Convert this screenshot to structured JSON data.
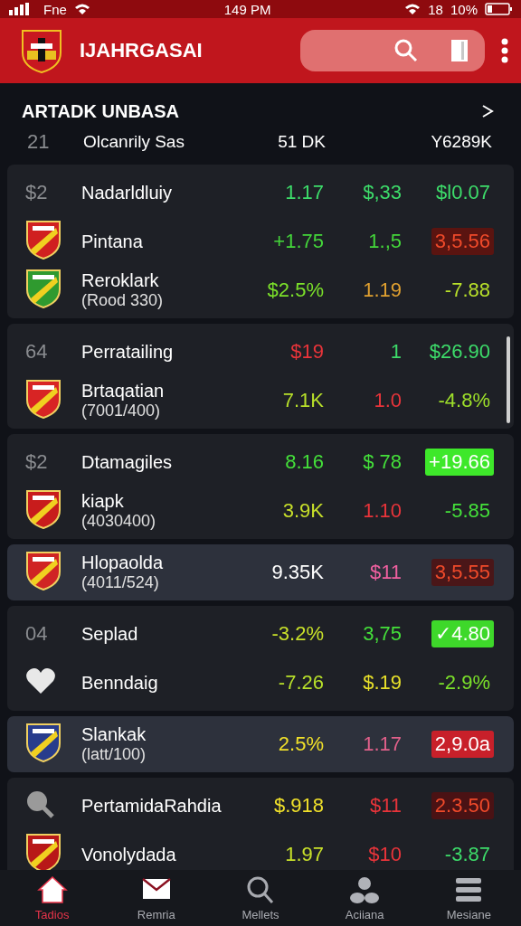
{
  "status_bar": {
    "carrier": "Fne",
    "time": "149 PM",
    "indicator": "18",
    "battery_text": "10%"
  },
  "app_bar": {
    "title": "IJAHRGASAI"
  },
  "section": {
    "title": "ARTADK UNBASA"
  },
  "header_row": {
    "number": "21",
    "name": "Olcanrily Sas",
    "column_a": "51 DK",
    "column_b": "Y6289K"
  },
  "groups": [
    {
      "highlighted": false,
      "rows": [
        {
          "lead": {
            "kind": "number",
            "text": "$2"
          },
          "name": "Nadarldluiy",
          "values": [
            {
              "text": "1.17",
              "color": "#3ddc6a"
            },
            {
              "text": "$,33",
              "color": "#3ddc6a"
            },
            {
              "text": "$l0.07",
              "color": "#3ddc6a"
            }
          ]
        },
        {
          "lead": {
            "kind": "crest",
            "color": "#d02020"
          },
          "name": "Pintana",
          "values": [
            {
              "text": "+1.75",
              "color": "#44d63a"
            },
            {
              "text": "1.,5",
              "color": "#44d63a"
            },
            {
              "text": "3,5.56",
              "kind": "tag",
              "color": "#5a1410"
            }
          ]
        },
        {
          "lead": {
            "kind": "crest",
            "color": "#2f9a2f"
          },
          "name": "Reroklark",
          "sub": "(Rood 330)",
          "values": [
            {
              "text": "$2.5%",
              "color": "#7be02a"
            },
            {
              "text": "1.19",
              "color": "#e0a030"
            },
            {
              "text": "-7.88",
              "color": "#b8e02a"
            }
          ]
        }
      ]
    },
    {
      "highlighted": false,
      "rows": [
        {
          "lead": {
            "kind": "number",
            "text": "64"
          },
          "name": "Perratailing",
          "values": [
            {
              "text": "$19",
              "color": "#e8343a"
            },
            {
              "text": "1",
              "color": "#3ddc6a"
            },
            {
              "text": "$26.90",
              "color": "#3ddc6a"
            }
          ]
        },
        {
          "lead": {
            "kind": "crest",
            "color": "#d82424"
          },
          "name": "Brtaqatian",
          "sub": "(7001/400)",
          "values": [
            {
              "text": "7.1K",
              "color": "#b8e02a"
            },
            {
              "text": "1.0",
              "color": "#e8343a"
            },
            {
              "text": "-4.8%",
              "color": "#9ee02a"
            }
          ]
        }
      ]
    },
    {
      "highlighted": false,
      "rows": [
        {
          "lead": {
            "kind": "number",
            "text": "$2"
          },
          "name": "Dtamagiles",
          "values": [
            {
              "text": "8.16",
              "color": "#44e03a"
            },
            {
              "text": "$ 78",
              "color": "#44e03a"
            },
            {
              "text": "+19.66",
              "kind": "tag",
              "color": "#3ee82a"
            }
          ]
        },
        {
          "lead": {
            "kind": "crest",
            "color": "#c81c1c"
          },
          "name": "kiapk",
          "sub": "(4030400)",
          "values": [
            {
              "text": "3.9K",
              "color": "#c8e02a"
            },
            {
              "text": "1.10",
              "color": "#e8343a"
            },
            {
              "text": "-5.85",
              "color": "#44e03a"
            }
          ]
        }
      ]
    },
    {
      "highlighted": true,
      "rows": [
        {
          "lead": {
            "kind": "crest",
            "color": "#d02424"
          },
          "name": "Hlopaolda",
          "sub": "(4011/524)",
          "values": [
            {
              "text": "9.35K",
              "color": "#ffffff"
            },
            {
              "text": "$11",
              "color": "#f060a0"
            },
            {
              "text": "3,5.55",
              "kind": "tag",
              "color": "#4a1618"
            }
          ]
        }
      ]
    },
    {
      "highlighted": false,
      "rows": [
        {
          "lead": {
            "kind": "number",
            "text": "04"
          },
          "name": "Seplad",
          "values": [
            {
              "text": "-3.2%",
              "color": "#c8e02a"
            },
            {
              "text": "3,75",
              "color": "#44e03a"
            },
            {
              "text": "✓4.80",
              "kind": "tag",
              "color": "#3ed82a"
            }
          ]
        },
        {
          "lead": {
            "kind": "heart"
          },
          "name": "Benndaig",
          "values": [
            {
              "text": "-7.26",
              "color": "#b8e02a"
            },
            {
              "text": "$.19",
              "color": "#e8e02a"
            },
            {
              "text": "-2.9%",
              "color": "#7be02a"
            }
          ]
        }
      ]
    },
    {
      "highlighted": true,
      "rows": [
        {
          "lead": {
            "kind": "crest",
            "color": "#283c8c"
          },
          "name": "Slankak",
          "sub": "(latt/100)",
          "values": [
            {
              "text": "2.5%",
              "color": "#f0e02a"
            },
            {
              "text": "1.17",
              "color": "#e0608a"
            },
            {
              "text": "2,9.0a",
              "kind": "tag",
              "color": "#c8202a"
            }
          ]
        }
      ]
    },
    {
      "highlighted": false,
      "rows": [
        {
          "lead": {
            "kind": "magnifier"
          },
          "name": "PertamidaRahdia",
          "values": [
            {
              "text": "$.918",
              "color": "#f0e02a"
            },
            {
              "text": "$11",
              "color": "#e8343a"
            },
            {
              "text": "2.3.50",
              "kind": "tag",
              "color": "#4a1214"
            }
          ]
        },
        {
          "lead": {
            "kind": "crest",
            "color": "#b81818"
          },
          "name": "Vonolydada",
          "values": [
            {
              "text": "1.97",
              "color": "#c8e02a"
            },
            {
              "text": "$10",
              "color": "#e8343a"
            },
            {
              "text": "-3.87",
              "color": "#3ddc6a"
            }
          ]
        }
      ]
    }
  ],
  "nav": [
    {
      "label": "Tadios",
      "selected": true
    },
    {
      "label": "Remria",
      "selected": false
    },
    {
      "label": "Mellets",
      "selected": false
    },
    {
      "label": "Aciiana",
      "selected": false
    },
    {
      "label": "Mesiane",
      "selected": false
    }
  ]
}
